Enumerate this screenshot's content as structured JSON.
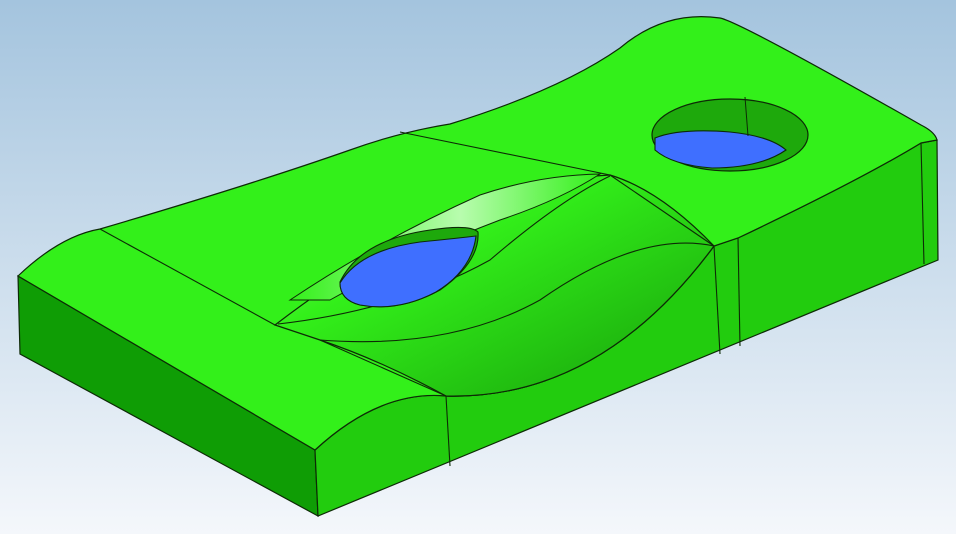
{
  "viewport": {
    "background_top_color": "#a4c4de",
    "background_bottom_color": "#f4f7fb"
  },
  "model": {
    "face_color": "#33f01a",
    "face_highlight_color": "#8ef87a",
    "face_shadow_color": "#1fb80f",
    "side_color": "#22cc0e",
    "front_color": "#0f9d05",
    "hole_color": "#3f6fff",
    "hole_wall_color": "#1ea90c",
    "edge_color": "#0d2a06"
  }
}
